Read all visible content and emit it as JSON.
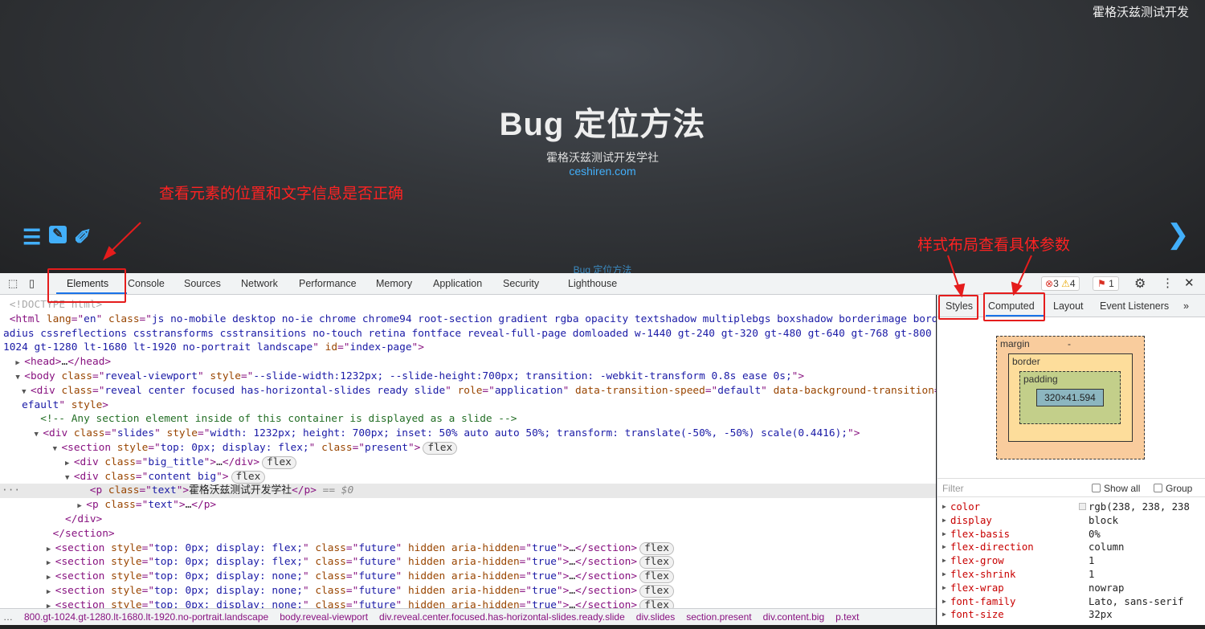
{
  "slide": {
    "brand": "霍格沃兹测试开发",
    "title": "Bug 定位方法",
    "subtitle": "霍格沃兹测试开发学社",
    "url": "ceshiren.com",
    "footer": "Bug 定位方法",
    "controls": {
      "menu_icon": "☰",
      "edit_icon": "✎",
      "pen_icon": "✐",
      "next_icon": "❯"
    },
    "accent": "#42affa"
  },
  "annotations": {
    "left": "查看元素的位置和文字信息是否正确",
    "right": "样式布局查看具体参数",
    "color": "#e51c1c"
  },
  "devtools": {
    "tabs": [
      "Elements",
      "Console",
      "Sources",
      "Network",
      "Performance",
      "Memory",
      "Application",
      "Security",
      "Lighthouse"
    ],
    "active_tab": "Elements",
    "errors": "3",
    "warnings": "4",
    "issues": "1",
    "code_lines": [
      [
        [
          "gr",
          "<!DOCTYPE html>"
        ]
      ],
      [
        [
          "tg",
          "<html "
        ],
        [
          "an",
          "lang"
        ],
        [
          "tg",
          "=\""
        ],
        [
          "av",
          "en"
        ],
        [
          "tg",
          "\" "
        ],
        [
          "an",
          "class"
        ],
        [
          "tg",
          "=\""
        ],
        [
          "av",
          "js no-mobile desktop no-ie chrome chrome94 root-section gradient rgba opacity textshadow multiplebgs boxshadow borderimage borderr"
        ]
      ],
      [
        [
          "av",
          "adius cssreflections csstransforms csstransitions no-touch retina fontface reveal-full-page domloaded w-1440 gt-240 gt-320 gt-480 gt-640 gt-768 gt-800 gt-"
        ]
      ],
      [
        [
          "av",
          "1024 gt-1280 lt-1680 lt-1920 no-portrait landscape"
        ],
        [
          "tg",
          "\" "
        ],
        [
          "an",
          "id"
        ],
        [
          "tg",
          "=\""
        ],
        [
          "av",
          "index-page"
        ],
        [
          "tg",
          "\">"
        ]
      ],
      [
        [
          "tri",
          "▶ "
        ],
        [
          "tg",
          "<head>"
        ],
        [
          "tx",
          "…"
        ],
        [
          "tg",
          "</head>"
        ]
      ],
      [
        [
          "tri",
          "▼ "
        ],
        [
          "tg",
          "<body "
        ],
        [
          "an",
          "class"
        ],
        [
          "tg",
          "=\""
        ],
        [
          "av",
          "reveal-viewport"
        ],
        [
          "tg",
          "\" "
        ],
        [
          "an",
          "style"
        ],
        [
          "tg",
          "=\""
        ],
        [
          "av",
          "--slide-width:1232px; --slide-height:700px; transition: -webkit-transform 0.8s ease 0s;"
        ],
        [
          "tg",
          "\">"
        ]
      ],
      [
        [
          "tri",
          "▼ "
        ],
        [
          "tg",
          "<div "
        ],
        [
          "an",
          "class"
        ],
        [
          "tg",
          "=\""
        ],
        [
          "av",
          "reveal center focused has-horizontal-slides ready slide"
        ],
        [
          "tg",
          "\" "
        ],
        [
          "an",
          "role"
        ],
        [
          "tg",
          "=\""
        ],
        [
          "av",
          "application"
        ],
        [
          "tg",
          "\" "
        ],
        [
          "an",
          "data-transition-speed"
        ],
        [
          "tg",
          "=\""
        ],
        [
          "av",
          "default"
        ],
        [
          "tg",
          "\" "
        ],
        [
          "an",
          "data-background-transition"
        ],
        [
          "tg",
          "=\""
        ],
        [
          "av",
          "d"
        ]
      ],
      [
        [
          "av",
          "efault"
        ],
        [
          "tg",
          "\" "
        ],
        [
          "an",
          "style"
        ],
        [
          "tg",
          ">"
        ]
      ],
      [
        [
          "cm",
          "<!-- Any section element inside of this container is displayed as a slide -->"
        ]
      ],
      [
        [
          "tri",
          "▼ "
        ],
        [
          "tg",
          "<div "
        ],
        [
          "an",
          "class"
        ],
        [
          "tg",
          "=\""
        ],
        [
          "av",
          "slides"
        ],
        [
          "tg",
          "\" "
        ],
        [
          "an",
          "style"
        ],
        [
          "tg",
          "=\""
        ],
        [
          "av",
          "width: 1232px; height: 700px; inset: 50% auto auto 50%; transform: translate(-50%, -50%) scale(0.4416);"
        ],
        [
          "tg",
          "\">"
        ]
      ],
      [
        [
          "tri",
          "▼ "
        ],
        [
          "tg",
          "<section "
        ],
        [
          "an",
          "style"
        ],
        [
          "tg",
          "=\""
        ],
        [
          "av",
          "top: 0px; display: flex;"
        ],
        [
          "tg",
          "\" "
        ],
        [
          "an",
          "class"
        ],
        [
          "tg",
          "=\""
        ],
        [
          "av",
          "present"
        ],
        [
          "tg",
          "\">"
        ],
        [
          "bd",
          "flex"
        ]
      ],
      [
        [
          "tri",
          "▶ "
        ],
        [
          "tg",
          "<div "
        ],
        [
          "an",
          "class"
        ],
        [
          "tg",
          "=\""
        ],
        [
          "av",
          "big_title"
        ],
        [
          "tg",
          "\">"
        ],
        [
          "tx",
          "…"
        ],
        [
          "tg",
          "</div>"
        ],
        [
          "bd",
          "flex"
        ]
      ],
      [
        [
          "tri",
          "▼ "
        ],
        [
          "tg",
          "<div "
        ],
        [
          "an",
          "class"
        ],
        [
          "tg",
          "=\""
        ],
        [
          "av",
          "content big"
        ],
        [
          "tg",
          "\">"
        ],
        [
          "bd",
          "flex"
        ]
      ],
      [
        [
          "tg",
          "<p "
        ],
        [
          "an",
          "class"
        ],
        [
          "tg",
          "=\""
        ],
        [
          "av",
          "text"
        ],
        [
          "tg",
          "\">"
        ],
        [
          "tx",
          "霍格沃兹测试开发学社"
        ],
        [
          "tg",
          "</p>"
        ],
        [
          "sv",
          " == $0"
        ]
      ],
      [
        [
          "tri",
          "▶ "
        ],
        [
          "tg",
          "<p "
        ],
        [
          "an",
          "class"
        ],
        [
          "tg",
          "=\""
        ],
        [
          "av",
          "text"
        ],
        [
          "tg",
          "\">"
        ],
        [
          "tx",
          "…"
        ],
        [
          "tg",
          "</p>"
        ]
      ],
      [
        [
          "tg",
          "</div>"
        ]
      ],
      [
        [
          "tg",
          "</section>"
        ]
      ],
      [
        [
          "tri",
          "▶ "
        ],
        [
          "tg",
          "<section "
        ],
        [
          "an",
          "style"
        ],
        [
          "tg",
          "=\""
        ],
        [
          "av",
          "top: 0px; display: flex;"
        ],
        [
          "tg",
          "\" "
        ],
        [
          "an",
          "class"
        ],
        [
          "tg",
          "=\""
        ],
        [
          "av",
          "future"
        ],
        [
          "tg",
          "\" "
        ],
        [
          "an",
          "hidden aria-hidden"
        ],
        [
          "tg",
          "=\""
        ],
        [
          "av",
          "true"
        ],
        [
          "tg",
          "\">"
        ],
        [
          "tx",
          "…"
        ],
        [
          "tg",
          "</section>"
        ],
        [
          "bd",
          "flex"
        ]
      ],
      [
        [
          "tri",
          "▶ "
        ],
        [
          "tg",
          "<section "
        ],
        [
          "an",
          "style"
        ],
        [
          "tg",
          "=\""
        ],
        [
          "av",
          "top: 0px; display: flex;"
        ],
        [
          "tg",
          "\" "
        ],
        [
          "an",
          "class"
        ],
        [
          "tg",
          "=\""
        ],
        [
          "av",
          "future"
        ],
        [
          "tg",
          "\" "
        ],
        [
          "an",
          "hidden aria-hidden"
        ],
        [
          "tg",
          "=\""
        ],
        [
          "av",
          "true"
        ],
        [
          "tg",
          "\">"
        ],
        [
          "tx",
          "…"
        ],
        [
          "tg",
          "</section>"
        ],
        [
          "bd",
          "flex"
        ]
      ],
      [
        [
          "tri",
          "▶ "
        ],
        [
          "tg",
          "<section "
        ],
        [
          "an",
          "style"
        ],
        [
          "tg",
          "=\""
        ],
        [
          "av",
          "top: 0px; display: none;"
        ],
        [
          "tg",
          "\" "
        ],
        [
          "an",
          "class"
        ],
        [
          "tg",
          "=\""
        ],
        [
          "av",
          "future"
        ],
        [
          "tg",
          "\" "
        ],
        [
          "an",
          "hidden aria-hidden"
        ],
        [
          "tg",
          "=\""
        ],
        [
          "av",
          "true"
        ],
        [
          "tg",
          "\">"
        ],
        [
          "tx",
          "…"
        ],
        [
          "tg",
          "</section>"
        ],
        [
          "bd",
          "flex"
        ]
      ],
      [
        [
          "tri",
          "▶ "
        ],
        [
          "tg",
          "<section "
        ],
        [
          "an",
          "style"
        ],
        [
          "tg",
          "=\""
        ],
        [
          "av",
          "top: 0px; display: none;"
        ],
        [
          "tg",
          "\" "
        ],
        [
          "an",
          "class"
        ],
        [
          "tg",
          "=\""
        ],
        [
          "av",
          "future"
        ],
        [
          "tg",
          "\" "
        ],
        [
          "an",
          "hidden aria-hidden"
        ],
        [
          "tg",
          "=\""
        ],
        [
          "av",
          "true"
        ],
        [
          "tg",
          "\">"
        ],
        [
          "tx",
          "…"
        ],
        [
          "tg",
          "</section>"
        ],
        [
          "bd",
          "flex"
        ]
      ],
      [
        [
          "tri",
          "▶ "
        ],
        [
          "tg",
          "<section "
        ],
        [
          "an",
          "style"
        ],
        [
          "tg",
          "=\""
        ],
        [
          "av",
          "top: 0px; display: none;"
        ],
        [
          "tg",
          "\" "
        ],
        [
          "an",
          "class"
        ],
        [
          "tg",
          "=\""
        ],
        [
          "av",
          "future"
        ],
        [
          "tg",
          "\" "
        ],
        [
          "an",
          "hidden aria-hidden"
        ],
        [
          "tg",
          "=\""
        ],
        [
          "av",
          "true"
        ],
        [
          "tg",
          "\">"
        ],
        [
          "tx",
          "…"
        ],
        [
          "tg",
          "</section>"
        ],
        [
          "bd",
          "flex"
        ]
      ]
    ],
    "code_indents": [
      1,
      1,
      0,
      0,
      2,
      2,
      3,
      3,
      6,
      5,
      8,
      10,
      10,
      14,
      12,
      10,
      8,
      7,
      7,
      7,
      7,
      7
    ],
    "selected_line": 13,
    "breadcrumbs": [
      "…",
      "800.gt-1024.gt-1280.lt-1680.lt-1920.no-portrait.landscape",
      "body.reveal-viewport",
      "div.reveal.center.focused.has-horizontal-slides.ready.slide",
      "div.slides",
      "section.present",
      "div.content.big",
      "p.text"
    ],
    "side_tabs": [
      "Styles",
      "Computed",
      "Layout",
      "Event Listeners",
      "»"
    ],
    "active_side_tab": "Computed",
    "box_model": {
      "margin": "margin",
      "border": "border",
      "padding": "padding",
      "content": "320×41.594",
      "dash": "-"
    },
    "filter_placeholder": "Filter",
    "show_all": "Show all",
    "group": "Group",
    "computed": [
      {
        "name": "color",
        "value": "rgb(238, 238, 238"
      },
      {
        "name": "display",
        "value": "block"
      },
      {
        "name": "flex-basis",
        "value": "0%"
      },
      {
        "name": "flex-direction",
        "value": "column"
      },
      {
        "name": "flex-grow",
        "value": "1"
      },
      {
        "name": "flex-shrink",
        "value": "1"
      },
      {
        "name": "flex-wrap",
        "value": "nowrap"
      },
      {
        "name": "font-family",
        "value": "Lato, sans-serif"
      },
      {
        "name": "font-size",
        "value": "32px"
      }
    ]
  }
}
